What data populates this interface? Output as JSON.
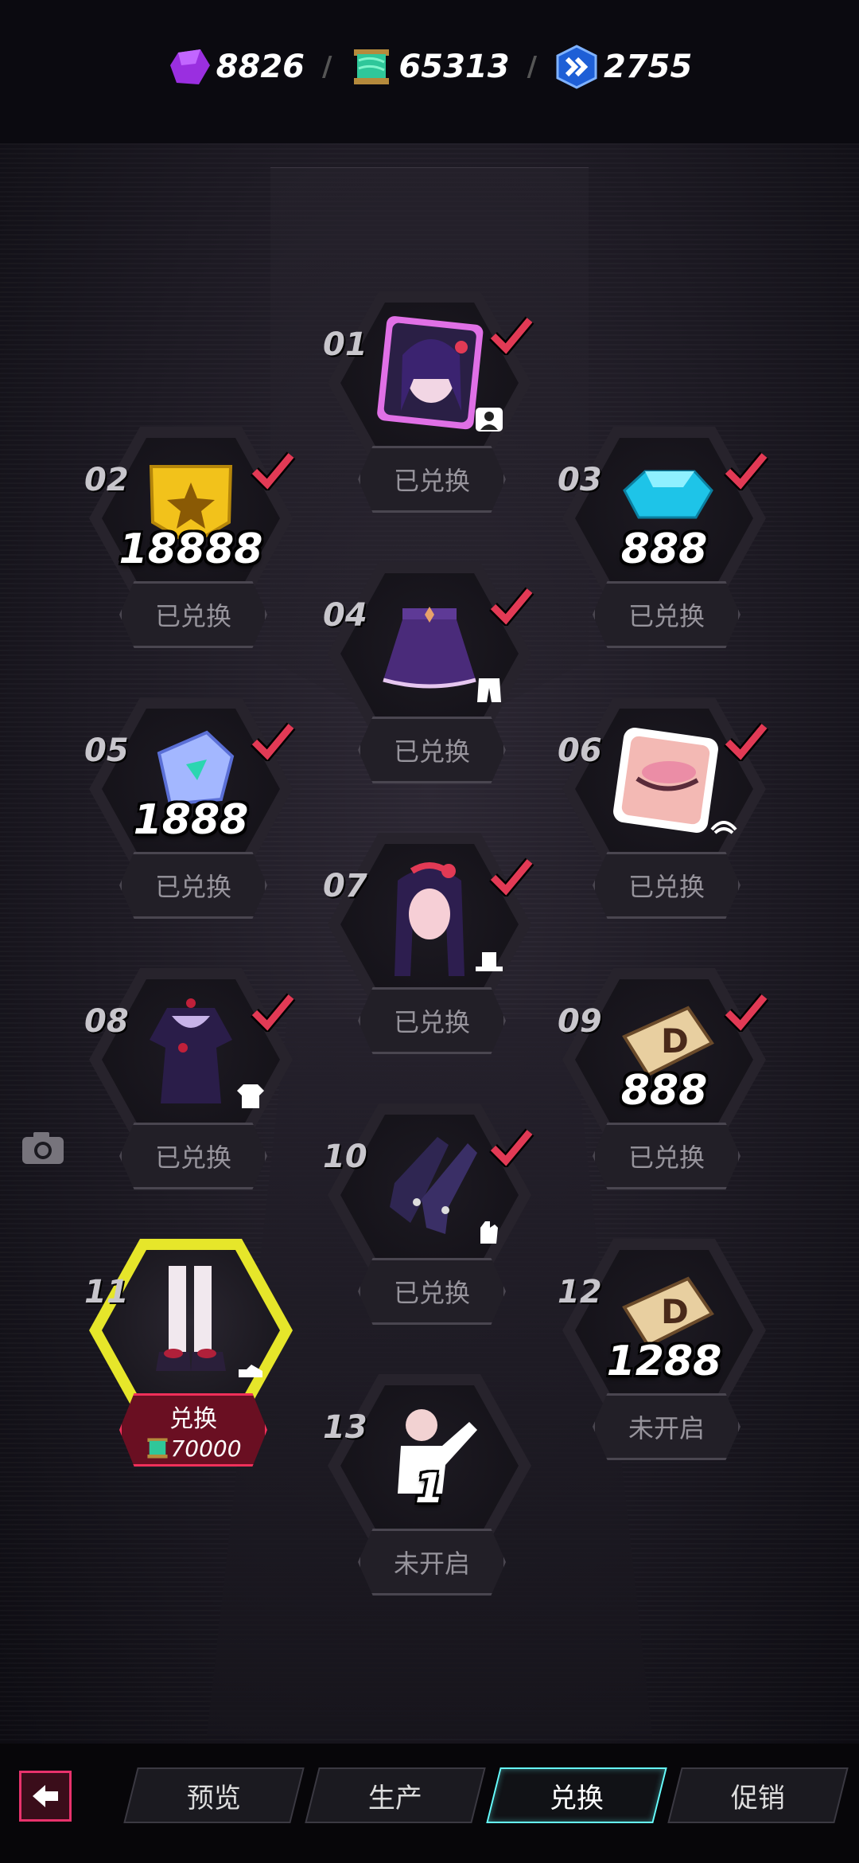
{
  "currency": [
    {
      "name": "purple-crystal",
      "value": "8826"
    },
    {
      "name": "green-scroll",
      "value": "65313"
    },
    {
      "name": "blue-chevron-token",
      "value": "2755"
    }
  ],
  "slots": [
    {
      "num": "01",
      "status": "已兑换",
      "item": "character-portrait",
      "amount": ""
    },
    {
      "num": "02",
      "status": "已兑换",
      "item": "gold-medal",
      "amount": "18888"
    },
    {
      "num": "03",
      "status": "已兑换",
      "item": "blue-gem",
      "amount": "888"
    },
    {
      "num": "04",
      "status": "已兑换",
      "item": "purple-skirt",
      "amount": ""
    },
    {
      "num": "05",
      "status": "已兑换",
      "item": "crystal-chip",
      "amount": "1888"
    },
    {
      "num": "06",
      "status": "已兑换",
      "item": "eye-makeup-card",
      "amount": ""
    },
    {
      "num": "07",
      "status": "已兑换",
      "item": "hair-headwear",
      "amount": ""
    },
    {
      "num": "08",
      "status": "已兑换",
      "item": "dark-dress",
      "amount": ""
    },
    {
      "num": "09",
      "status": "已兑换",
      "item": "d-ticket",
      "amount": "888"
    },
    {
      "num": "10",
      "status": "已兑换",
      "item": "lace-gloves",
      "amount": ""
    },
    {
      "num": "11",
      "status": "兑换",
      "item": "stockings-shoes",
      "amount": "",
      "cost": "70000"
    },
    {
      "num": "12",
      "status": "未开启",
      "item": "d-ticket",
      "amount": "1288"
    },
    {
      "num": "13",
      "status": "未开启",
      "item": "pose-emote",
      "amount": "1"
    }
  ],
  "tabs": [
    "预览",
    "生产",
    "兑换",
    "促销"
  ],
  "active_tab": "兑换",
  "colors": {
    "accent": "#e8326c",
    "check": "#e23a55",
    "active_border": "#e6e62a",
    "tab_active": "#66ffff"
  }
}
